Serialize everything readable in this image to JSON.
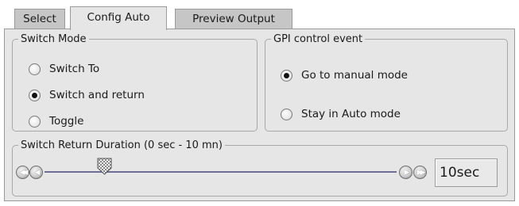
{
  "tabs": [
    {
      "label": "Select",
      "active": false
    },
    {
      "label": "Config Auto",
      "active": true
    },
    {
      "label": "Preview Output",
      "active": false
    }
  ],
  "switch_mode": {
    "title": "Switch Mode",
    "options": [
      {
        "label": "Switch To",
        "checked": false
      },
      {
        "label": "Switch and return",
        "checked": true
      },
      {
        "label": "Toggle",
        "checked": false
      }
    ]
  },
  "gpi_control": {
    "title": "GPI control event",
    "options": [
      {
        "label": "Go to manual mode",
        "checked": true
      },
      {
        "label": "Stay in Auto mode",
        "checked": false
      }
    ]
  },
  "duration": {
    "title": "Switch Return Duration (0 sec - 10 mn)",
    "value": "10sec",
    "position_fraction": 0.17,
    "icons": {
      "first": "skip-to-start-icon",
      "prev": "step-back-icon",
      "next": "step-forward-icon",
      "last": "skip-to-end-icon"
    }
  },
  "colors": {
    "panel_bg": "#e6e6e6",
    "tab_bg": "#c6c6c6",
    "track": "#6e6e96"
  }
}
